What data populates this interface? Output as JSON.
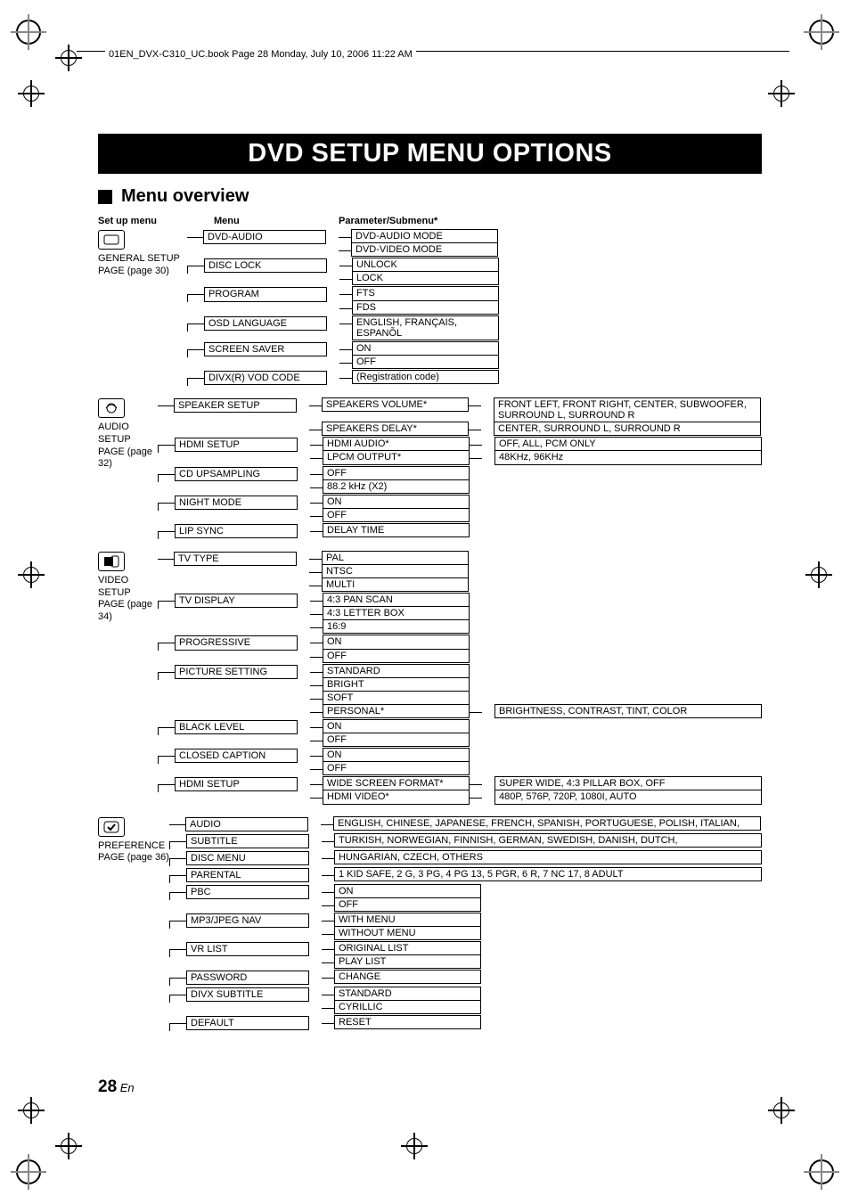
{
  "header_text": "01EN_DVX-C310_UC.book  Page 28  Monday, July 10, 2006  11:22 AM",
  "title": "DVD SETUP MENU OPTIONS",
  "section_heading": "Menu overview",
  "columns": {
    "c1": "Set up menu",
    "c2": "Menu",
    "c3": "Parameter/Submenu*"
  },
  "page_number": "28",
  "page_lang": "En",
  "groups": [
    {
      "icon": "general",
      "label": "GENERAL SETUP PAGE (page 30)",
      "menus": [
        {
          "name": "DVD-AUDIO",
          "params": [
            {
              "v": "DVD-AUDIO MODE"
            },
            {
              "v": "DVD-VIDEO MODE"
            }
          ]
        },
        {
          "name": "DISC LOCK",
          "params": [
            {
              "v": "UNLOCK"
            },
            {
              "v": "LOCK"
            }
          ]
        },
        {
          "name": "PROGRAM",
          "params": [
            {
              "v": "FTS"
            },
            {
              "v": "FDS"
            }
          ]
        },
        {
          "name": "OSD LANGUAGE",
          "params": [
            {
              "v": "ENGLISH, FRANÇAIS, ESPANÕL"
            }
          ]
        },
        {
          "name": "SCREEN SAVER",
          "params": [
            {
              "v": "ON"
            },
            {
              "v": "OFF"
            }
          ]
        },
        {
          "name": "DIVX(R) VOD CODE",
          "params": [
            {
              "v": "(Registration code)"
            }
          ]
        }
      ]
    },
    {
      "icon": "audio",
      "label": "AUDIO SETUP PAGE (page 32)",
      "menus": [
        {
          "name": "SPEAKER SETUP",
          "params": [
            {
              "v": "SPEAKERS VOLUME*",
              "details": [
                "FRONT LEFT, FRONT RIGHT, CENTER, SUBWOOFER, SURROUND L, SURROUND R"
              ]
            },
            {
              "v": "SPEAKERS DELAY*",
              "details": [
                "CENTER, SURROUND L, SURROUND R"
              ]
            }
          ]
        },
        {
          "name": "HDMI SETUP",
          "params": [
            {
              "v": "HDMI AUDIO*",
              "details": [
                "OFF, ALL, PCM ONLY"
              ]
            },
            {
              "v": "LPCM OUTPUT*",
              "details": [
                "48KHz, 96KHz"
              ]
            }
          ]
        },
        {
          "name": "CD UPSAMPLING",
          "params": [
            {
              "v": "OFF"
            },
            {
              "v": "88.2 kHz (X2)"
            }
          ]
        },
        {
          "name": "NIGHT MODE",
          "params": [
            {
              "v": "ON"
            },
            {
              "v": "OFF"
            }
          ]
        },
        {
          "name": "LIP SYNC",
          "params": [
            {
              "v": "DELAY TIME"
            }
          ]
        }
      ]
    },
    {
      "icon": "video",
      "label": "VIDEO SETUP PAGE (page 34)",
      "menus": [
        {
          "name": "TV TYPE",
          "params": [
            {
              "v": "PAL"
            },
            {
              "v": "NTSC"
            },
            {
              "v": "MULTI"
            }
          ]
        },
        {
          "name": "TV DISPLAY",
          "params": [
            {
              "v": "4:3 PAN SCAN"
            },
            {
              "v": "4:3 LETTER BOX"
            },
            {
              "v": "16:9"
            }
          ]
        },
        {
          "name": "PROGRESSIVE",
          "params": [
            {
              "v": "ON"
            },
            {
              "v": "OFF"
            }
          ]
        },
        {
          "name": "PICTURE SETTING",
          "params": [
            {
              "v": "STANDARD"
            },
            {
              "v": "BRIGHT"
            },
            {
              "v": "SOFT"
            },
            {
              "v": "PERSONAL*",
              "details": [
                "BRIGHTNESS, CONTRAST, TINT, COLOR"
              ]
            }
          ]
        },
        {
          "name": "BLACK LEVEL",
          "params": [
            {
              "v": "ON"
            },
            {
              "v": "OFF"
            }
          ]
        },
        {
          "name": "CLOSED CAPTION",
          "params": [
            {
              "v": "ON"
            },
            {
              "v": "OFF"
            }
          ]
        },
        {
          "name": "HDMI SETUP",
          "params": [
            {
              "v": "WIDE SCREEN FORMAT*",
              "details": [
                "SUPER WIDE, 4:3 PILLAR BOX, OFF"
              ]
            },
            {
              "v": "HDMI VIDEO*",
              "details": [
                "480P, 576P, 720P, 1080I, AUTO"
              ]
            }
          ]
        }
      ]
    },
    {
      "icon": "pref",
      "label": "PREFERENCE PAGE (page 36)",
      "menus": [
        {
          "name": "AUDIO",
          "params": [
            {
              "v": "ENGLISH, CHINESE, JAPANESE, FRENCH, SPANISH, PORTUGUESE, POLISH, ITALIAN,",
              "wide": true
            }
          ]
        },
        {
          "name": "SUBTITLE",
          "params": [
            {
              "v": "TURKISH, NORWEGIAN, FINNISH, GERMAN, SWEDISH, DANISH, DUTCH,",
              "wide": true
            }
          ]
        },
        {
          "name": "DISC MENU",
          "params": [
            {
              "v": "HUNGARIAN, CZECH, OTHERS",
              "wide": true
            }
          ]
        },
        {
          "name": "PARENTAL",
          "params": [
            {
              "v": "1 KID SAFE, 2 G, 3 PG, 4 PG 13, 5 PGR, 6 R, 7 NC 17, 8 ADULT",
              "wide": true
            }
          ]
        },
        {
          "name": "PBC",
          "params": [
            {
              "v": "ON"
            },
            {
              "v": "OFF"
            }
          ]
        },
        {
          "name": "MP3/JPEG NAV",
          "params": [
            {
              "v": "WITH MENU"
            },
            {
              "v": "WITHOUT MENU"
            }
          ]
        },
        {
          "name": "VR LIST",
          "params": [
            {
              "v": "ORIGINAL LIST"
            },
            {
              "v": "PLAY LIST"
            }
          ]
        },
        {
          "name": "PASSWORD",
          "params": [
            {
              "v": "CHANGE"
            }
          ]
        },
        {
          "name": "DIVX SUBTITLE",
          "params": [
            {
              "v": "STANDARD"
            },
            {
              "v": "CYRILLIC"
            }
          ]
        },
        {
          "name": "DEFAULT",
          "params": [
            {
              "v": "RESET"
            }
          ]
        }
      ]
    }
  ]
}
